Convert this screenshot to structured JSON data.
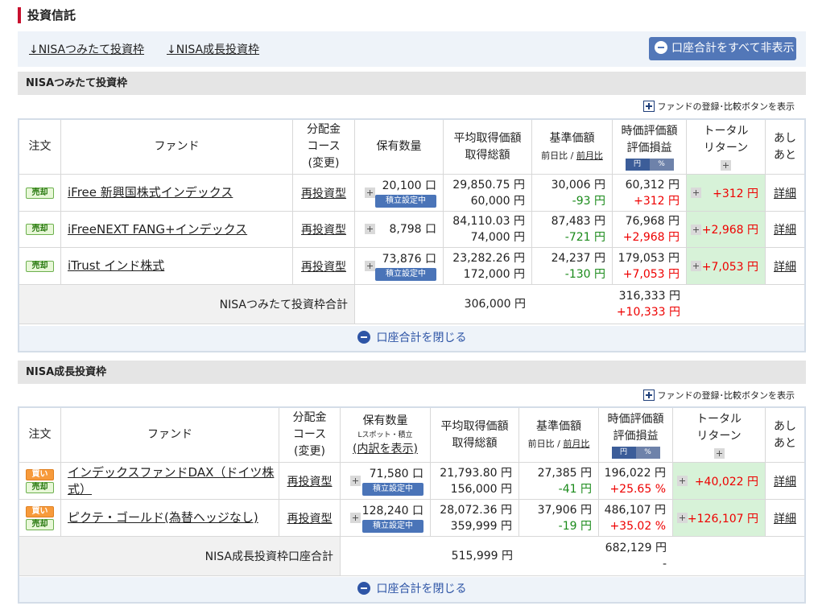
{
  "page_title": "投資信託",
  "anchor_links": [
    "↓NISAつみたて投資枠",
    "↓NISA成長投資枠"
  ],
  "hide_all_label": "口座合計をすべて非表示",
  "fund_register_label": "ファンドの登録･比較ボタンを表示",
  "close_label": "口座合計を閉じる",
  "toggle": {
    "yen": "円",
    "pct": "%"
  },
  "tsumitate_badge": "積立設定中",
  "section1": {
    "title": "NISAつみたて投資枠",
    "headers": {
      "order": "注文",
      "fund": "ファンド",
      "dist": [
        "分配金",
        "コース",
        "(変更)"
      ],
      "qty": "保有数量",
      "avg": [
        "平均取得価額",
        "取得総額"
      ],
      "base": "基準価額",
      "base_sub": [
        "前日比",
        "/",
        "前月比"
      ],
      "val": [
        "時価評価額",
        "評価損益"
      ],
      "ret": [
        "トータル",
        "リターン"
      ],
      "ashi": [
        "あし",
        "あと"
      ]
    },
    "rows": [
      {
        "badges": [
          "売却"
        ],
        "fund": "iFree 新興国株式インデックス",
        "dist": "再投資型",
        "qty": "20,100 口",
        "tsumitate": true,
        "avg": "29,850.75 円",
        "cost": "60,000 円",
        "base": "30,006 円",
        "base_chg": "-93 円",
        "val": "60,312 円",
        "pl": "+312 円",
        "ret": "+312 円",
        "detail": "詳細"
      },
      {
        "badges": [
          "売却"
        ],
        "fund": "iFreeNEXT FANG+インデックス",
        "dist": "再投資型",
        "qty": "8,798 口",
        "tsumitate": false,
        "avg": "84,110.03 円",
        "cost": "74,000 円",
        "base": "87,483 円",
        "base_chg": "-721 円",
        "val": "76,968 円",
        "pl": "+2,968 円",
        "ret": "+2,968 円",
        "detail": "詳細"
      },
      {
        "badges": [
          "売却"
        ],
        "fund": "iTrust インド株式",
        "dist": "再投資型",
        "qty": "73,876 口",
        "tsumitate": true,
        "avg": "23,282.26 円",
        "cost": "172,000 円",
        "base": "24,237 円",
        "base_chg": "-130 円",
        "val": "179,053 円",
        "pl": "+7,053 円",
        "ret": "+7,053 円",
        "detail": "詳細"
      }
    ],
    "total": {
      "label": "NISAつみたて投資枠合計",
      "cost": "306,000 円",
      "val": "316,333 円",
      "pl": "+10,333 円"
    }
  },
  "section2": {
    "title": "NISA成長投資枠",
    "headers": {
      "order": "注文",
      "fund": "ファンド",
      "dist": [
        "分配金",
        "コース",
        "(変更)"
      ],
      "qty": [
        "保有数量",
        "Lスポット・積立",
        "(内訳を表示)"
      ],
      "avg": [
        "平均取得価額",
        "取得総額"
      ],
      "base": "基準価額",
      "base_sub": [
        "前日比",
        "/",
        "前月比"
      ],
      "val": [
        "時価評価額",
        "評価損益"
      ],
      "ret": [
        "トータル",
        "リターン"
      ],
      "ashi": [
        "あし",
        "あと"
      ]
    },
    "rows": [
      {
        "badges": [
          "買い",
          "売却"
        ],
        "fund": "インデックスファンドDAX（ドイツ株式）",
        "dist": "再投資型",
        "qty": "71,580 口",
        "tsumitate": true,
        "avg": "21,793.80 円",
        "cost": "156,000 円",
        "base": "27,385 円",
        "base_chg": "-41 円",
        "val": "196,022 円",
        "pl": "+25.65 %",
        "ret": "+40,022 円",
        "detail": "詳細"
      },
      {
        "badges": [
          "買い",
          "売却"
        ],
        "fund": "ピクテ・ゴールド(為替ヘッジなし)",
        "dist": "再投資型",
        "qty": "128,240 口",
        "tsumitate": true,
        "avg": "28,072.36 円",
        "cost": "359,999 円",
        "base": "37,906 円",
        "base_chg": "-19 円",
        "val": "486,107 円",
        "pl": "+35.02 %",
        "ret": "+126,107 円",
        "detail": "詳細"
      }
    ],
    "total": {
      "label": "NISA成長投資枠口座合計",
      "cost": "515,999 円",
      "val": "682,129 円",
      "pl": "-"
    }
  }
}
